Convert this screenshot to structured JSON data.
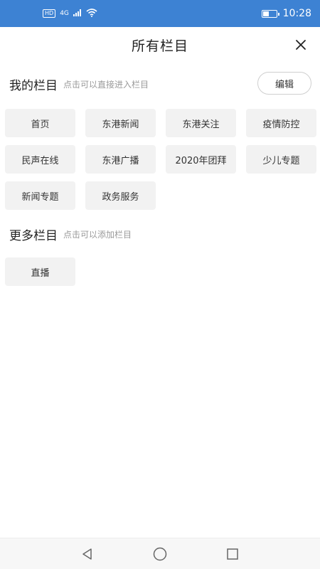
{
  "status_bar": {
    "hd": "HD",
    "network": "4G",
    "time": "10:28",
    "battery_level": 0.4
  },
  "header": {
    "title": "所有栏目"
  },
  "my_channels": {
    "title": "我的栏目",
    "hint": "点击可以直接进入栏目",
    "edit_label": "编辑",
    "items": [
      "首页",
      "东港新闻",
      "东港关注",
      "疫情防控",
      "民声在线",
      "东港广播",
      "2020年团拜",
      "少儿专题",
      "新闻专题",
      "政务服务"
    ]
  },
  "more_channels": {
    "title": "更多栏目",
    "hint": "点击可以添加栏目",
    "items": [
      "直播"
    ]
  },
  "colors": {
    "status_bar": "#3d82d3",
    "chip_bg": "#f2f2f2",
    "hint": "#9a9a9a"
  }
}
